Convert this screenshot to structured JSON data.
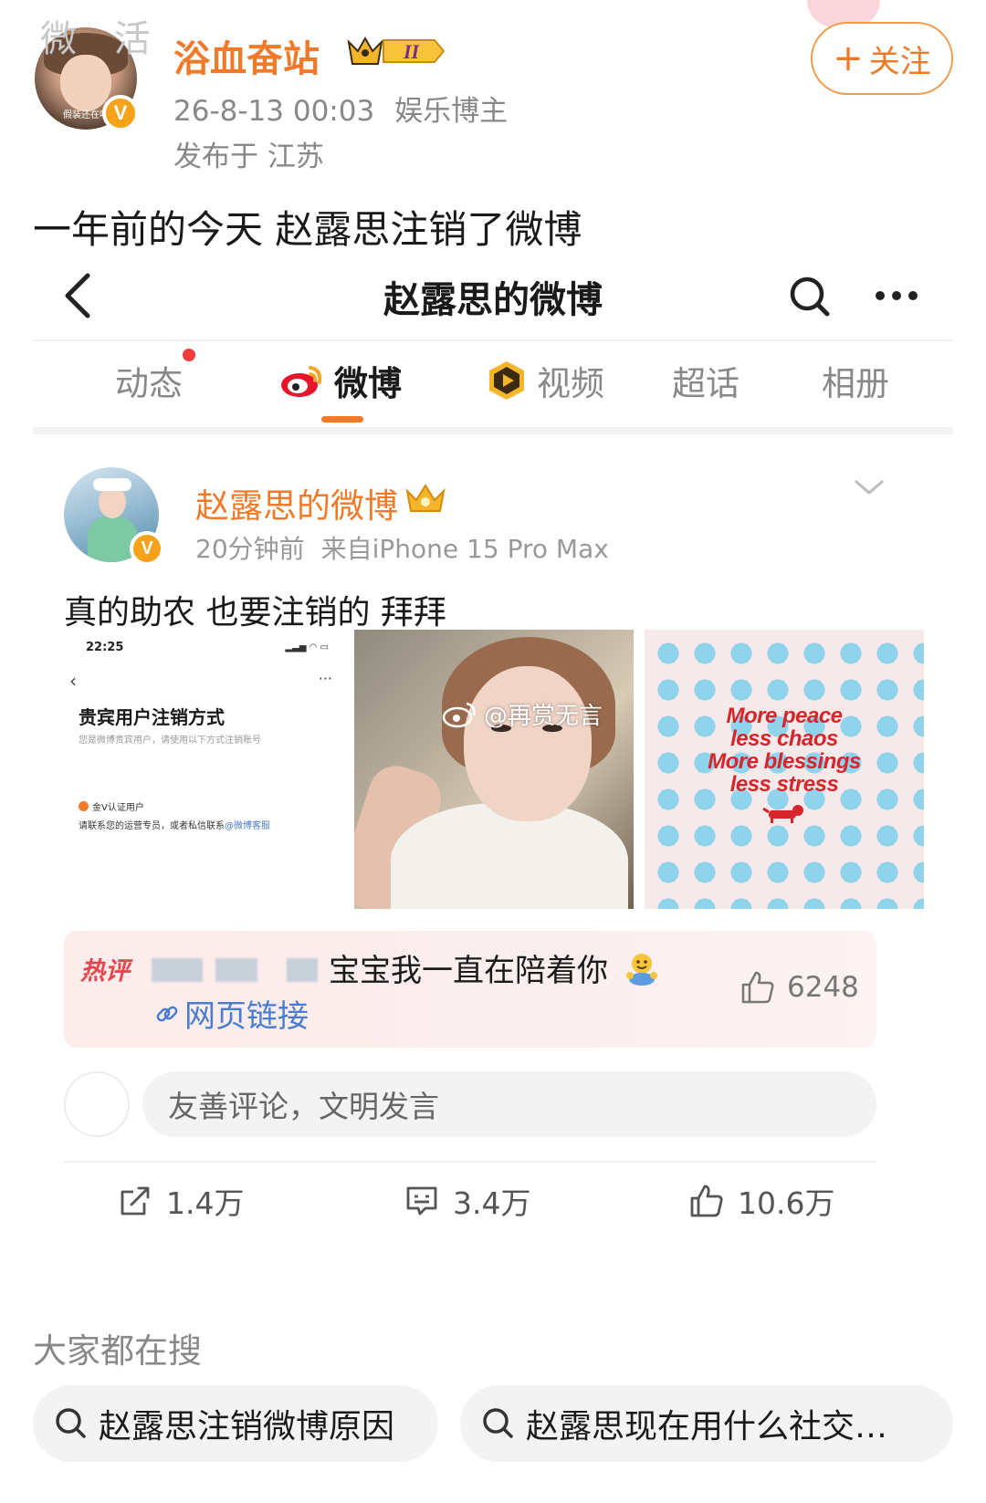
{
  "post": {
    "watermark_corner": "微 活",
    "avatar_caption": "假装还在吗",
    "author_name": "浴血奋站",
    "level_badge": "II",
    "date": "26-8-13 00:03",
    "category": "娱乐博主",
    "location": "发布于 江苏",
    "follow_plus": "+",
    "follow_label": "关注",
    "text": "一年前的今天 赵露思注销了微博"
  },
  "embedded": {
    "title": "赵露思的微博",
    "tabs": [
      {
        "label": "动态"
      },
      {
        "label": "微博"
      },
      {
        "label": "视频"
      },
      {
        "label": "超话"
      },
      {
        "label": "相册"
      }
    ],
    "inner_post": {
      "author_name": "赵露思的微博",
      "time": "20分钟前",
      "source": "来自iPhone 15 Pro Max",
      "text": "真的助农 也要注销的 拜拜",
      "image_watermark": "@再赏无言",
      "screenshot": {
        "time": "22:25",
        "back": "‹",
        "more": "···",
        "title": "贵宾用户注销方式",
        "subtitle": "您是微博贵宾用户，请使用以下方式注销账号",
        "vip_label": "金V认证用户",
        "contact": "请联系您的运营专员，或者私信联系",
        "contact_link": "@微博客服"
      },
      "poster": {
        "line1": "More peace",
        "line2": "less chaos",
        "line3": "More blessings",
        "line4": "less stress"
      }
    },
    "hot_comment": {
      "tag": "热评",
      "text": "宝宝我一直在陪着你",
      "link": "网页链接",
      "likes": "6248"
    },
    "comment_placeholder": "友善评论，文明发言",
    "actions": {
      "reposts": "1.4万",
      "comments": "3.4万",
      "likes": "10.6万"
    }
  },
  "search": {
    "heading": "大家都在搜",
    "chips": [
      {
        "label": "赵露思注销微博原因"
      },
      {
        "label": "赵露思现在用什么社交…"
      }
    ]
  },
  "colors": {
    "brand_orange": "#f07a2a",
    "verified_badge": "#f7a21b",
    "link_blue": "#4a7ccf",
    "hot_red": "#e8454d"
  }
}
